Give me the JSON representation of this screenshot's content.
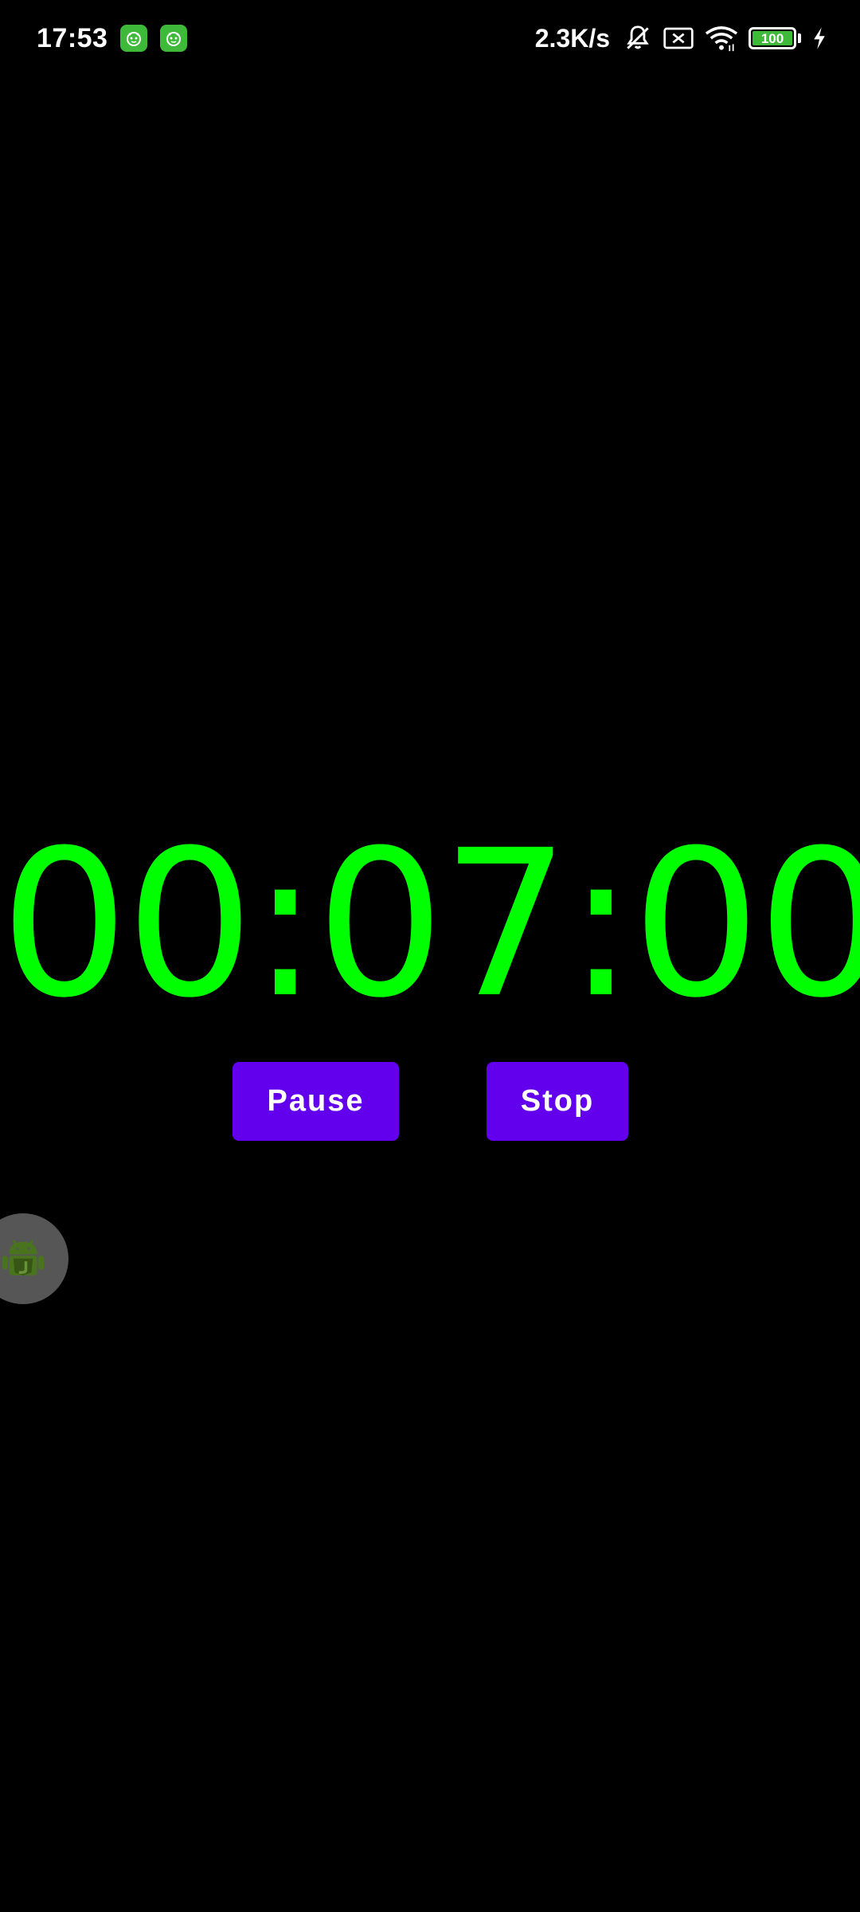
{
  "status_bar": {
    "time": "17:53",
    "net_speed": "2.3K/s",
    "battery_level": "100",
    "notification_icons": [
      "app-notification-icon",
      "app-notification-icon"
    ],
    "system_icons": [
      "bell-muted-icon",
      "sim-disabled-icon",
      "wifi-icon",
      "battery-icon",
      "charging-bolt-icon"
    ]
  },
  "timer": {
    "display": "00:07:00",
    "color": "#00ff00"
  },
  "controls": {
    "pause_label": "Pause",
    "stop_label": "Stop",
    "button_color": "#6200ee"
  },
  "floating_button": {
    "icon": "android-js-icon"
  }
}
